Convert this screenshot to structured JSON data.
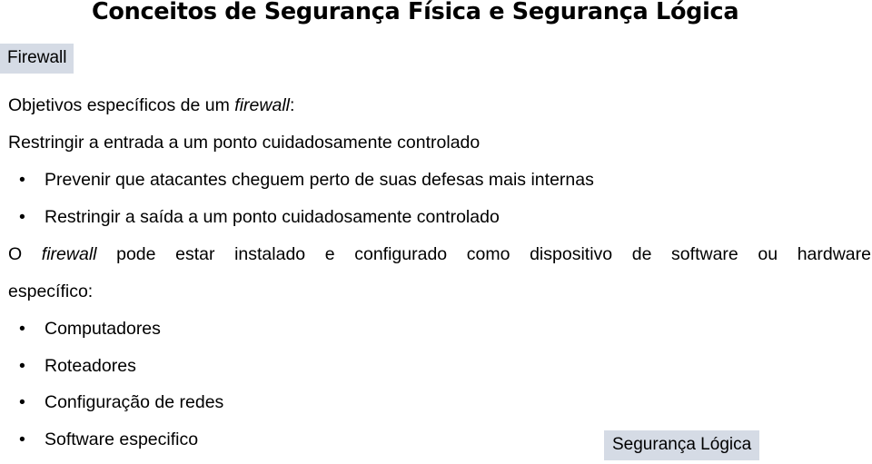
{
  "slide": {
    "title": "Conceitos de Segurança Física e Segurança Lógica",
    "section_tag": "Firewall",
    "intro": {
      "prefix": "Objetivos específicos de um ",
      "emphasis": "firewall",
      "suffix": ":"
    },
    "objective": "Restringir a entrada a um ponto cuidadosamente controlado",
    "objective_bullets": [
      "Prevenir que atacantes cheguem perto de suas defesas mais internas",
      "Restringir a saída a um ponto cuidadosamente controlado"
    ],
    "install": {
      "prefix": "O ",
      "emphasis": "firewall",
      "line1_rest": " pode estar instalado e configurado como dispositivo de software ou hardware",
      "line2": "específico:"
    },
    "device_bullets": [
      "Computadores",
      "Roteadores",
      "Configuração de redes",
      "Software especifico"
    ],
    "footer_tag": "Segurança Lógica",
    "bullet_glyph": "•"
  },
  "colors": {
    "tag_background": "#d5dbe5",
    "text": "#000000",
    "background": "#ffffff"
  }
}
